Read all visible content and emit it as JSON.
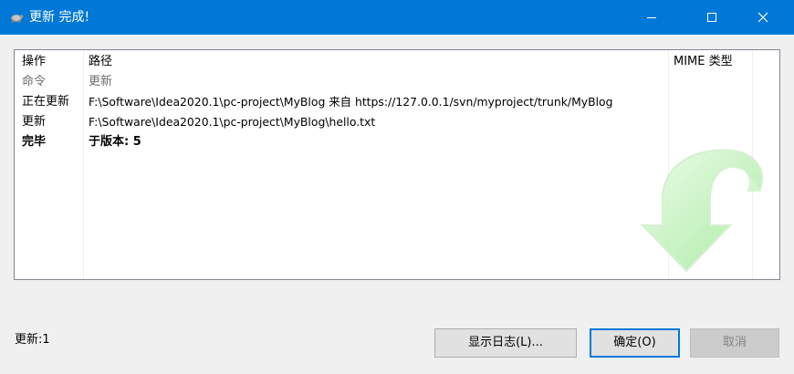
{
  "window": {
    "title": "更新 完成!",
    "controls": [
      "minimize",
      "maximize",
      "close"
    ]
  },
  "table": {
    "columns": [
      "操作",
      "路径",
      "MIME 类型"
    ],
    "rows": [
      {
        "action": "命令",
        "path": "更新",
        "style": "gray"
      },
      {
        "action": "正在更新",
        "path": "F:\\Software\\Idea2020.1\\pc-project\\MyBlog 来自 https://127.0.0.1/svn/myproject/trunk/MyBlog",
        "style": "normal"
      },
      {
        "action": "更新",
        "path": "F:\\Software\\Idea2020.1\\pc-project\\MyBlog\\hello.txt",
        "style": "normal"
      },
      {
        "action": "完毕",
        "path": "于版本: 5",
        "style": "bold"
      }
    ]
  },
  "status": "更新:1",
  "buttons": {
    "show_log": "显示日志(L)...",
    "ok": "确定(O)",
    "cancel": "取消"
  },
  "colors": {
    "titlebar": "#0078d7",
    "background": "#f0f0f0",
    "arrow": "#b8f2b0"
  },
  "icons": {
    "app": "tortoise-icon",
    "watermark": "green-update-arrow-icon"
  }
}
